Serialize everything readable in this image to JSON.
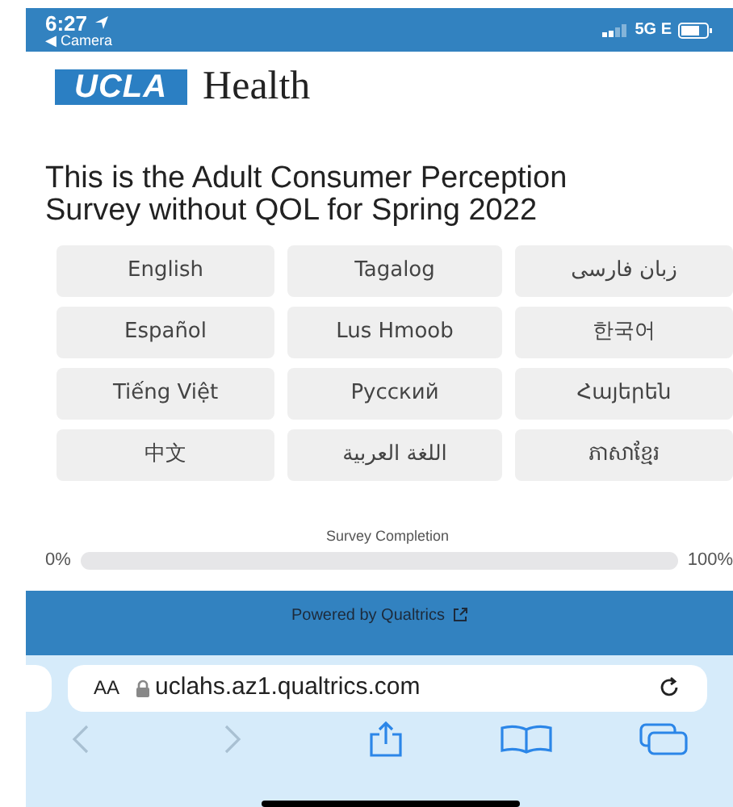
{
  "status_bar": {
    "time": "6:27",
    "back_app": "◀ Camera",
    "network": "5G E"
  },
  "header": {
    "logo_box": "UCLA",
    "logo_word": "Health"
  },
  "title": "This is the Adult Consumer Perception Survey without QOL for Spring 2022",
  "languages": [
    {
      "label": "English"
    },
    {
      "label": "Tagalog"
    },
    {
      "label": "زبان فارسی"
    },
    {
      "label": "Español"
    },
    {
      "label": "Lus Hmoob"
    },
    {
      "label": "한국어"
    },
    {
      "label": "Tiếng Việt"
    },
    {
      "label": "Русский"
    },
    {
      "label": "Հայերեն"
    },
    {
      "label": "中文"
    },
    {
      "label": "اللغة العربية"
    },
    {
      "label": "ភាសាខ្មែរ"
    }
  ],
  "progress": {
    "label": "Survey Completion",
    "start": "0%",
    "end": "100%",
    "level": 0
  },
  "footer": {
    "text": "Powered by Qualtrics"
  },
  "browser": {
    "text_size": "AA",
    "url": "uclahs.az1.qualtrics.com"
  }
}
